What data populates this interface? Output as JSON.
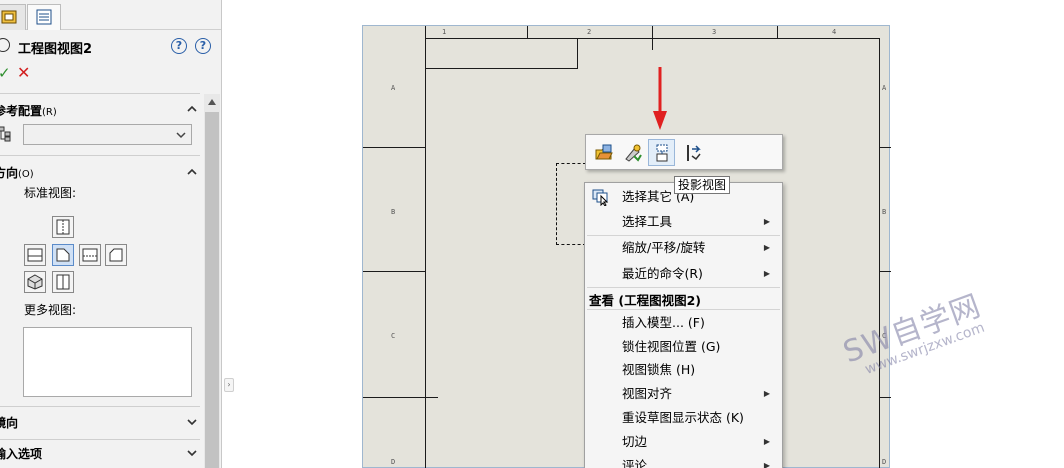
{
  "panel": {
    "title": "工程图视图2",
    "help_a": "?",
    "help_b": "?",
    "ok_glyph": "✓",
    "cancel_glyph": "✕",
    "group_reference": {
      "title": "参考配置",
      "key": "(R)"
    },
    "group_orientation": {
      "title": "方向",
      "key": "(O)"
    },
    "standard_views_label": "标准视图:",
    "more_views_label": "更多视图:",
    "group_mirror": {
      "title": "镜向"
    },
    "group_import": {
      "title": "输入选项"
    },
    "collapse_glyph": "⌃",
    "expand_glyph": "⌄"
  },
  "sheet": {
    "column_labels": [
      "1",
      "2",
      "3",
      "4"
    ],
    "row_labels_left": [
      "A",
      "B",
      "C",
      "D"
    ],
    "row_labels_right": [
      "A",
      "B",
      "C",
      "D"
    ]
  },
  "context_toolbar": {
    "buttons": [
      "open-part-icon",
      "zoom-to-selection-icon",
      "projected-view-icon",
      "align-view-icon"
    ],
    "tooltip": "投影视图"
  },
  "context_menu": {
    "items": [
      {
        "label": "选择其它 (A)",
        "submenu": false,
        "icon": "select-other-icon"
      },
      {
        "label": "选择工具",
        "submenu": true
      },
      {
        "label": "缩放/平移/旋转",
        "submenu": true
      },
      {
        "label": "最近的命令(R)",
        "submenu": true
      },
      {
        "label": "插入模型... (F)",
        "submenu": false
      },
      {
        "label": "锁住视图位置 (G)",
        "submenu": false
      },
      {
        "label": "视图锁焦 (H)",
        "submenu": false
      },
      {
        "label": "视图对齐",
        "submenu": true
      },
      {
        "label": "重设草图显示状态 (K)",
        "submenu": false
      },
      {
        "label": "切边",
        "submenu": true
      },
      {
        "label": "评论",
        "submenu": true
      }
    ],
    "section_header": "查看 (工程图视图2)",
    "submenu_glyph": "▶"
  },
  "watermark": {
    "main": "SW自学网",
    "sub": "www.swrjzxw.com"
  },
  "colors": {
    "sheet_bg": "#e4e3db",
    "accent_red": "#e02020",
    "ok_green": "#2f8f2f"
  }
}
